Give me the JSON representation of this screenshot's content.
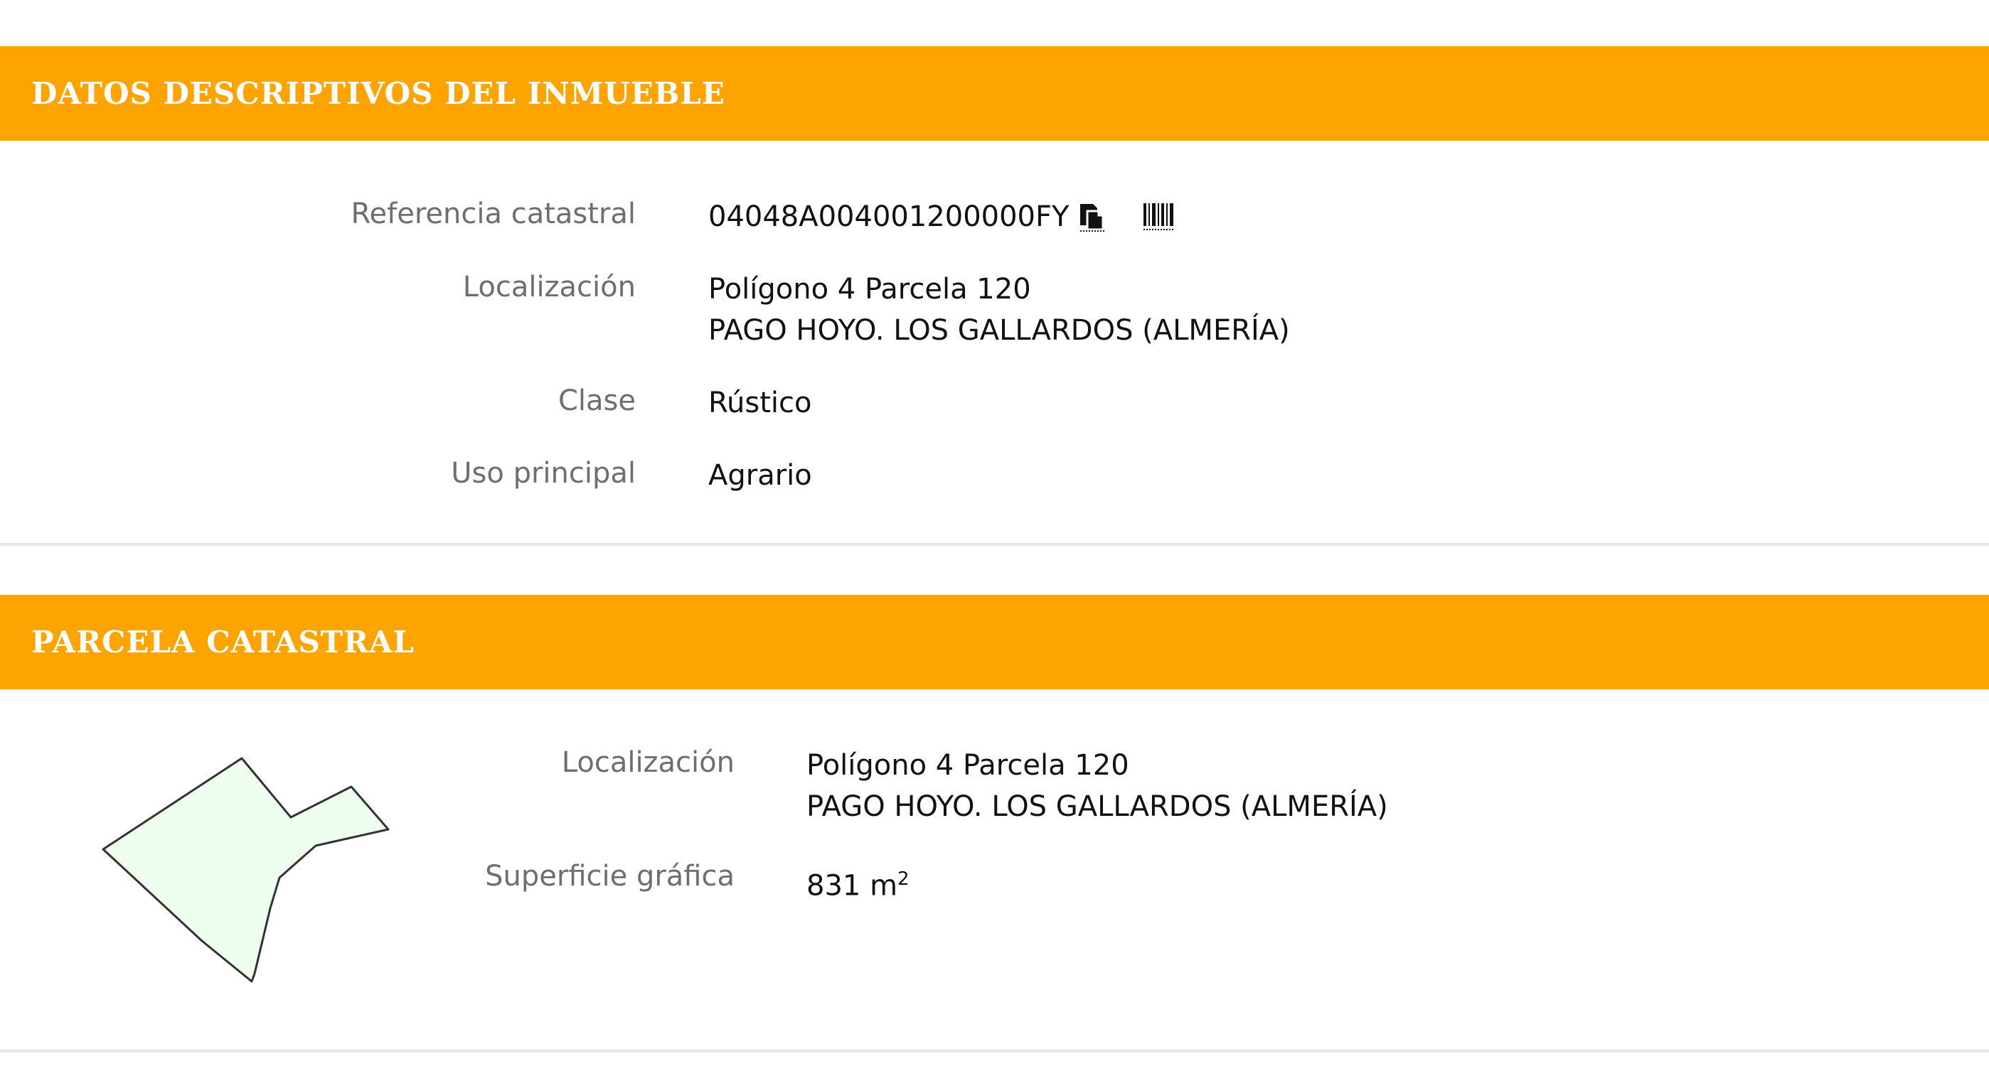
{
  "datos": {
    "title": "DATOS DESCRIPTIVOS DEL INMUEBLE",
    "rows": {
      "referencia": {
        "label": "Referencia catastral",
        "value": "04048A004001200000FY"
      },
      "localizacion": {
        "label": "Localización",
        "line1": "Polígono 4 Parcela 120",
        "line2": "PAGO HOYO. LOS GALLARDOS (ALMERÍA)"
      },
      "clase": {
        "label": "Clase",
        "value": "Rústico"
      },
      "uso": {
        "label": "Uso principal",
        "value": "Agrario"
      }
    },
    "icons": {
      "copy": "copy-icon",
      "barcode": "barcode-icon"
    }
  },
  "parcela": {
    "title": "PARCELA CATASTRAL",
    "rows": {
      "localizacion": {
        "label": "Localización",
        "line1": "Polígono 4 Parcela 120",
        "line2": "PAGO HOYO. LOS GALLARDOS (ALMERÍA)"
      },
      "superficie": {
        "label": "Superficie gráfica",
        "value": "831 m",
        "unit_sup": "2"
      }
    },
    "shape": {
      "fill": "#efffef",
      "stroke": "#333333"
    }
  },
  "colors": {
    "header": "#fda400",
    "header_text": "#ffffff",
    "label": "#6e6e6e",
    "value": "#111111",
    "divider": "#e6e6e6"
  }
}
